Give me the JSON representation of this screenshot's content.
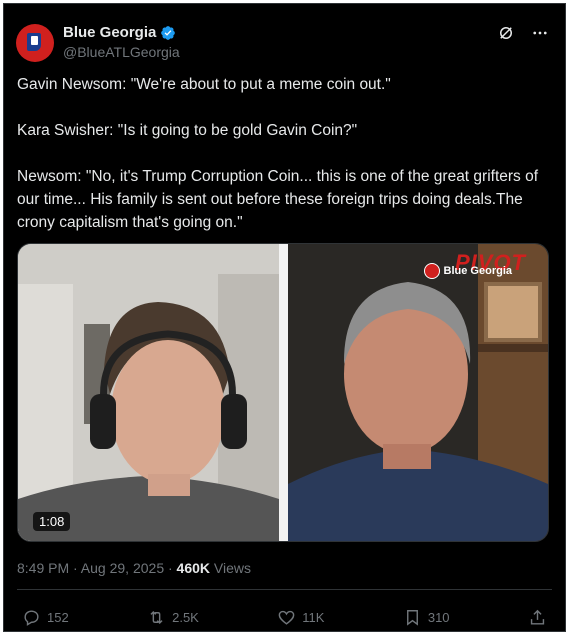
{
  "author": {
    "display_name": "Blue Georgia",
    "handle": "@BlueATLGeorgia",
    "verified": true
  },
  "header_icons": [
    "grok-icon",
    "more-icon"
  ],
  "tweet": {
    "paragraphs": [
      "Gavin Newsom: \"We're about to put a meme coin out.\"",
      "Kara Swisher: \"Is it going to be gold Gavin Coin?\"",
      "Newsom: \"No, it's Trump Corruption Coin... this is one of the great grifters of our time... His family is sent out before these foreign trips doing deals.The crony capitalism that's going on.\""
    ]
  },
  "media": {
    "duration": "1:08",
    "logo_text": "PIVOT",
    "watermark": "Blue Georgia"
  },
  "meta": {
    "timestamp": "8:49 PM · Aug 29, 2025 · ",
    "views_count": "460K",
    "views_label": " Views"
  },
  "actions": {
    "replies": "152",
    "reposts": "2.5K",
    "likes": "11K",
    "bookmarks": "310"
  },
  "colors": {
    "background": "#000000",
    "text": "#e7e9ea",
    "muted": "#71767b",
    "verified": "#1d9bf0",
    "brand_red": "#d0201e"
  }
}
